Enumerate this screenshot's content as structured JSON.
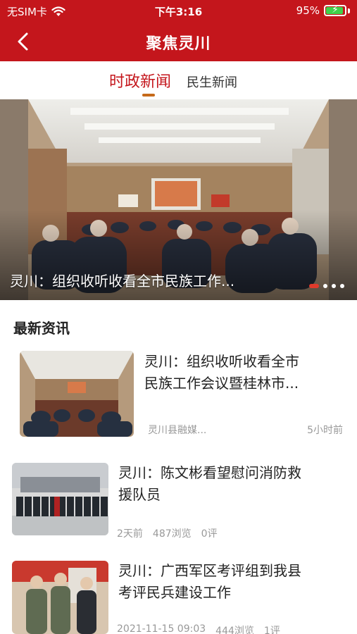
{
  "status_bar": {
    "carrier": "无SIM卡",
    "time": "下午3:16",
    "battery": "95%"
  },
  "nav": {
    "title": "聚焦灵川"
  },
  "tabs": [
    {
      "label": "时政新闻",
      "active": true
    },
    {
      "label": "民生新闻",
      "active": false
    }
  ],
  "banner": {
    "caption": "灵川：组织收听收看全市民族工作...",
    "slides": 4,
    "active_slide": 1
  },
  "section": {
    "title": "最新资讯"
  },
  "news": [
    {
      "title_line1": "灵川：组织收听收看全市",
      "title_line2": "民族工作会议暨桂林市...",
      "source": "灵川县融媒...",
      "time": "5小时前"
    },
    {
      "title_line1": "灵川：陈文彬看望慰问消防救",
      "title_line2": "援队员",
      "time": "2天前",
      "views": "487浏览",
      "comments": "0评"
    },
    {
      "title_line1": "灵川：广西军区考评组到我县",
      "title_line2": "考评民兵建设工作",
      "time": "2021-11-15 09:03",
      "views": "444浏览",
      "comments": "1评"
    }
  ],
  "colors": {
    "brand_red": "#c4161c",
    "tab_indicator": "#c66a1a",
    "meta_gray": "#999999"
  }
}
